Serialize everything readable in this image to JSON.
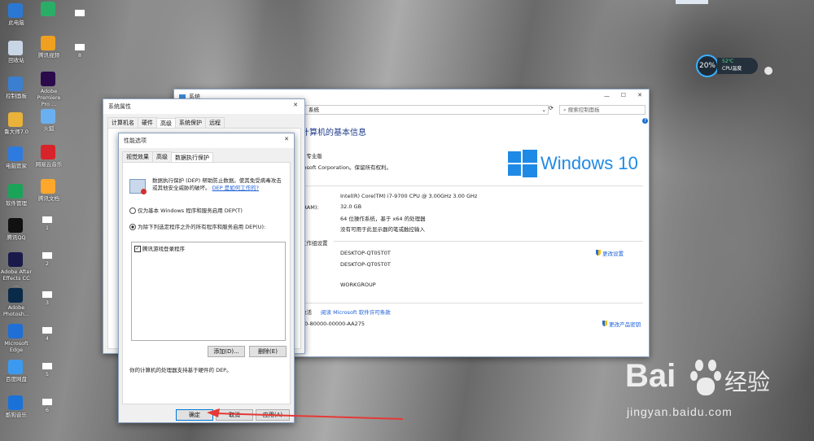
{
  "desktop": {
    "icons": [
      {
        "label": "此电脑",
        "icon": "computer-icon",
        "color": "#2b78d4"
      },
      {
        "label": "回收站",
        "icon": "recycle-bin-icon",
        "color": "#c9d6e6"
      },
      {
        "label": "控制面板",
        "icon": "control-panel-icon",
        "color": "#3b7fd1"
      },
      {
        "label": "鲁大师7.0",
        "icon": "master-lu-icon",
        "color": "#e9b23a"
      },
      {
        "label": "电脑管家",
        "icon": "pc-manager-icon",
        "color": "#2d7be0"
      },
      {
        "label": "软件管理",
        "icon": "software-manager-icon",
        "color": "#1aa45a"
      },
      {
        "label": "腾讯QQ",
        "icon": "qq-icon",
        "color": "#111111"
      },
      {
        "label": "Adobe After Effects CC ...",
        "icon": "after-effects-icon",
        "color": "#1a1a4a"
      },
      {
        "label": "Adobe Photosh...",
        "icon": "photoshop-icon",
        "color": "#0a2a4a"
      },
      {
        "label": "Microsoft Edge",
        "icon": "edge-icon",
        "color": "#1f6fd6"
      },
      {
        "label": "百度网盘",
        "icon": "baidu-netdisk-icon",
        "color": "#3b9af0"
      },
      {
        "label": "酷狗音乐",
        "icon": "kugou-icon",
        "color": "#1a72d8"
      }
    ],
    "icons2": [
      {
        "label": "",
        "icon": "wechat-icon",
        "color": "#2aae67"
      },
      {
        "label": "腾讯视频",
        "icon": "tencent-video-icon",
        "color": "#f0a020"
      },
      {
        "label": "Adobe Premiere Pro ...",
        "icon": "premiere-icon",
        "color": "#2a0a4a"
      },
      {
        "label": "火狐",
        "icon": "feather-icon",
        "color": "#6ab0f0"
      },
      {
        "label": "网易云音乐",
        "icon": "netease-music-icon",
        "color": "#d8232a"
      },
      {
        "label": "腾讯文档",
        "icon": "tencent-docs-icon",
        "color": "#ffa72a"
      }
    ],
    "files_col3": [
      "8"
    ],
    "files_col2": [
      "1",
      "2",
      "3",
      "4",
      "5",
      "6"
    ]
  },
  "cpu_widget": {
    "percent": "20%",
    "temp": "52℃",
    "label": "CPU温度"
  },
  "system_window": {
    "title": "系统",
    "address": "系统",
    "search_placeholder": "搜索控制面板",
    "heading": "计算机的基本信息",
    "edition_suffix": "0 专业版",
    "copyright": "rosoft Corporation。保留所有权利。",
    "brand": "Windows 10",
    "ram_label": "(RAM):",
    "processor": "Intel(R) Core(TM) i7-9700 CPU @ 3.00GHz   3.00 GHz",
    "ram": "32.0 GB",
    "system_type": "64 位操作系统，基于 x64 的处理器",
    "pen": "没有可用于此显示器的笔或触控输入",
    "workgroup_section": "工作组设置",
    "computer_name": "DESKTOP-QT05T0T",
    "full_name": "DESKTOP-QT05T0T",
    "workgroup": "WORKGROUP",
    "change_settings": "更改设置",
    "activation_prefix": "激活",
    "license_link": "阅读 Microsoft 软件许可条款",
    "product_id": "30-80000-00000-AA275",
    "change_key": "更改产品密钥",
    "controls": {
      "min": "—",
      "max": "☐",
      "close": "✕"
    }
  },
  "sys_props": {
    "title": "系统属性",
    "tabs": [
      "计算机名",
      "硬件",
      "高级",
      "系统保护",
      "远程"
    ],
    "close": "✕"
  },
  "perf_options": {
    "title": "性能选项",
    "tabs": [
      "视觉效果",
      "高级",
      "数据执行保护"
    ],
    "description": "数据执行保护 (DEP) 帮助防止数据。使其免受病毒攻击或其他安全威胁的破坏。",
    "link": "DEP 是如何工作的?",
    "radio1": "仅为基本 Windows 程序和服务启用 DEP(T)",
    "radio2": "为除下列选定程序之外的所有程序和服务启用 DEP(U):",
    "list_items": [
      "腾讯游戏登录程序"
    ],
    "add_button": "添加(D)...",
    "remove_button": "删除(E)",
    "status": "你的计算机的处理器支持基于硬件的 DEP。",
    "ok_button": "确定",
    "cancel_button": "取消",
    "apply_button": "应用(A)",
    "close": "✕"
  },
  "watermark": {
    "brand": "Bai",
    "brand2": "经验",
    "url": "jingyan.baidu.com"
  }
}
